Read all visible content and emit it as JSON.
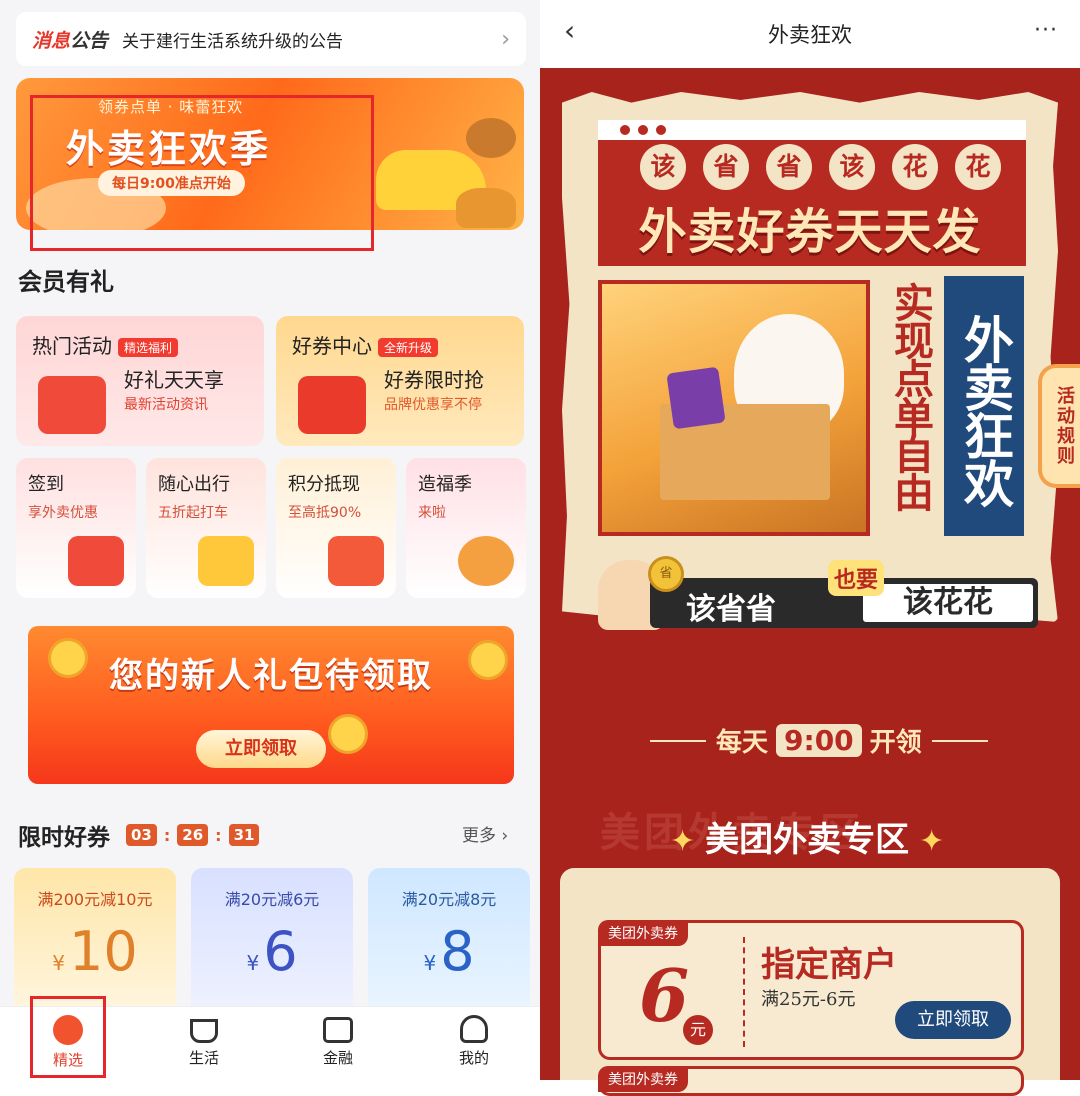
{
  "left": {
    "notice": {
      "tag_red": "消息",
      "tag_dark": "公告",
      "text": "关于建行生活系统升级的公告",
      "chevron": "›"
    },
    "hero": {
      "subtitle": "领券点单 · 味蕾狂欢",
      "title": "外卖狂欢季",
      "pill": "每日9:00准点开始"
    },
    "section_title": "会员有礼",
    "cards": [
      {
        "title": "热门活动",
        "badge": "精选福利",
        "headline": "好礼天天享",
        "sub": "最新活动资讯"
      },
      {
        "title": "好券中心",
        "badge": "全新升级",
        "headline": "好券限时抢",
        "sub": "品牌优惠享不停"
      }
    ],
    "tiles": [
      {
        "title": "签到",
        "sub": "享外卖优惠"
      },
      {
        "title": "随心出行",
        "sub": "五折起打车"
      },
      {
        "title": "积分抵现",
        "sub": "至高抵90%"
      },
      {
        "title": "造福季",
        "sub": "来啦"
      }
    ],
    "newbie": {
      "title": "您的新人礼包待领取",
      "button": "立即领取"
    },
    "limited": {
      "title": "限时好券",
      "hh": "03",
      "mm": "26",
      "ss": "31",
      "more": "更多 ›"
    },
    "coupons": [
      {
        "cond": "满200元减10元",
        "currency": "¥",
        "value": "10"
      },
      {
        "cond": "满20元减6元",
        "currency": "¥",
        "value": "6"
      },
      {
        "cond": "满20元减8元",
        "currency": "¥",
        "value": "8"
      }
    ],
    "tabs": [
      {
        "label": "精选"
      },
      {
        "label": "生活"
      },
      {
        "label": "金融"
      },
      {
        "label": "我的"
      }
    ]
  },
  "right": {
    "nav": {
      "back": "‹",
      "title": "外卖狂欢",
      "more": "···"
    },
    "circles": [
      "该",
      "省",
      "省",
      "该",
      "花",
      "花"
    ],
    "headline": "外卖好券天天发",
    "vertical_red": "实现点单自由",
    "vertical_blue": "外卖狂欢",
    "rule_tab": "活动规则",
    "slogan": {
      "a": "该省省",
      "b": "也要",
      "c": "该花花",
      "coin": "省"
    },
    "daily": {
      "pre": "每天",
      "time": "9:00",
      "post": "开领"
    },
    "zone_ghost": "美团外卖专区",
    "zone": "美团外卖专区",
    "voucher": {
      "label": "美团外卖券",
      "amount": "6",
      "unit": "元",
      "shop": "指定商户",
      "cond": "满25元-6元",
      "button": "立即领取"
    },
    "voucher2": {
      "label": "美团外卖券"
    }
  },
  "colors": {
    "accent_red": "#b72a22",
    "brand_orange": "#ff6a1a",
    "navy": "#214a7c",
    "paper": "#f4e4c6",
    "highlight_box": "#e5262a"
  }
}
